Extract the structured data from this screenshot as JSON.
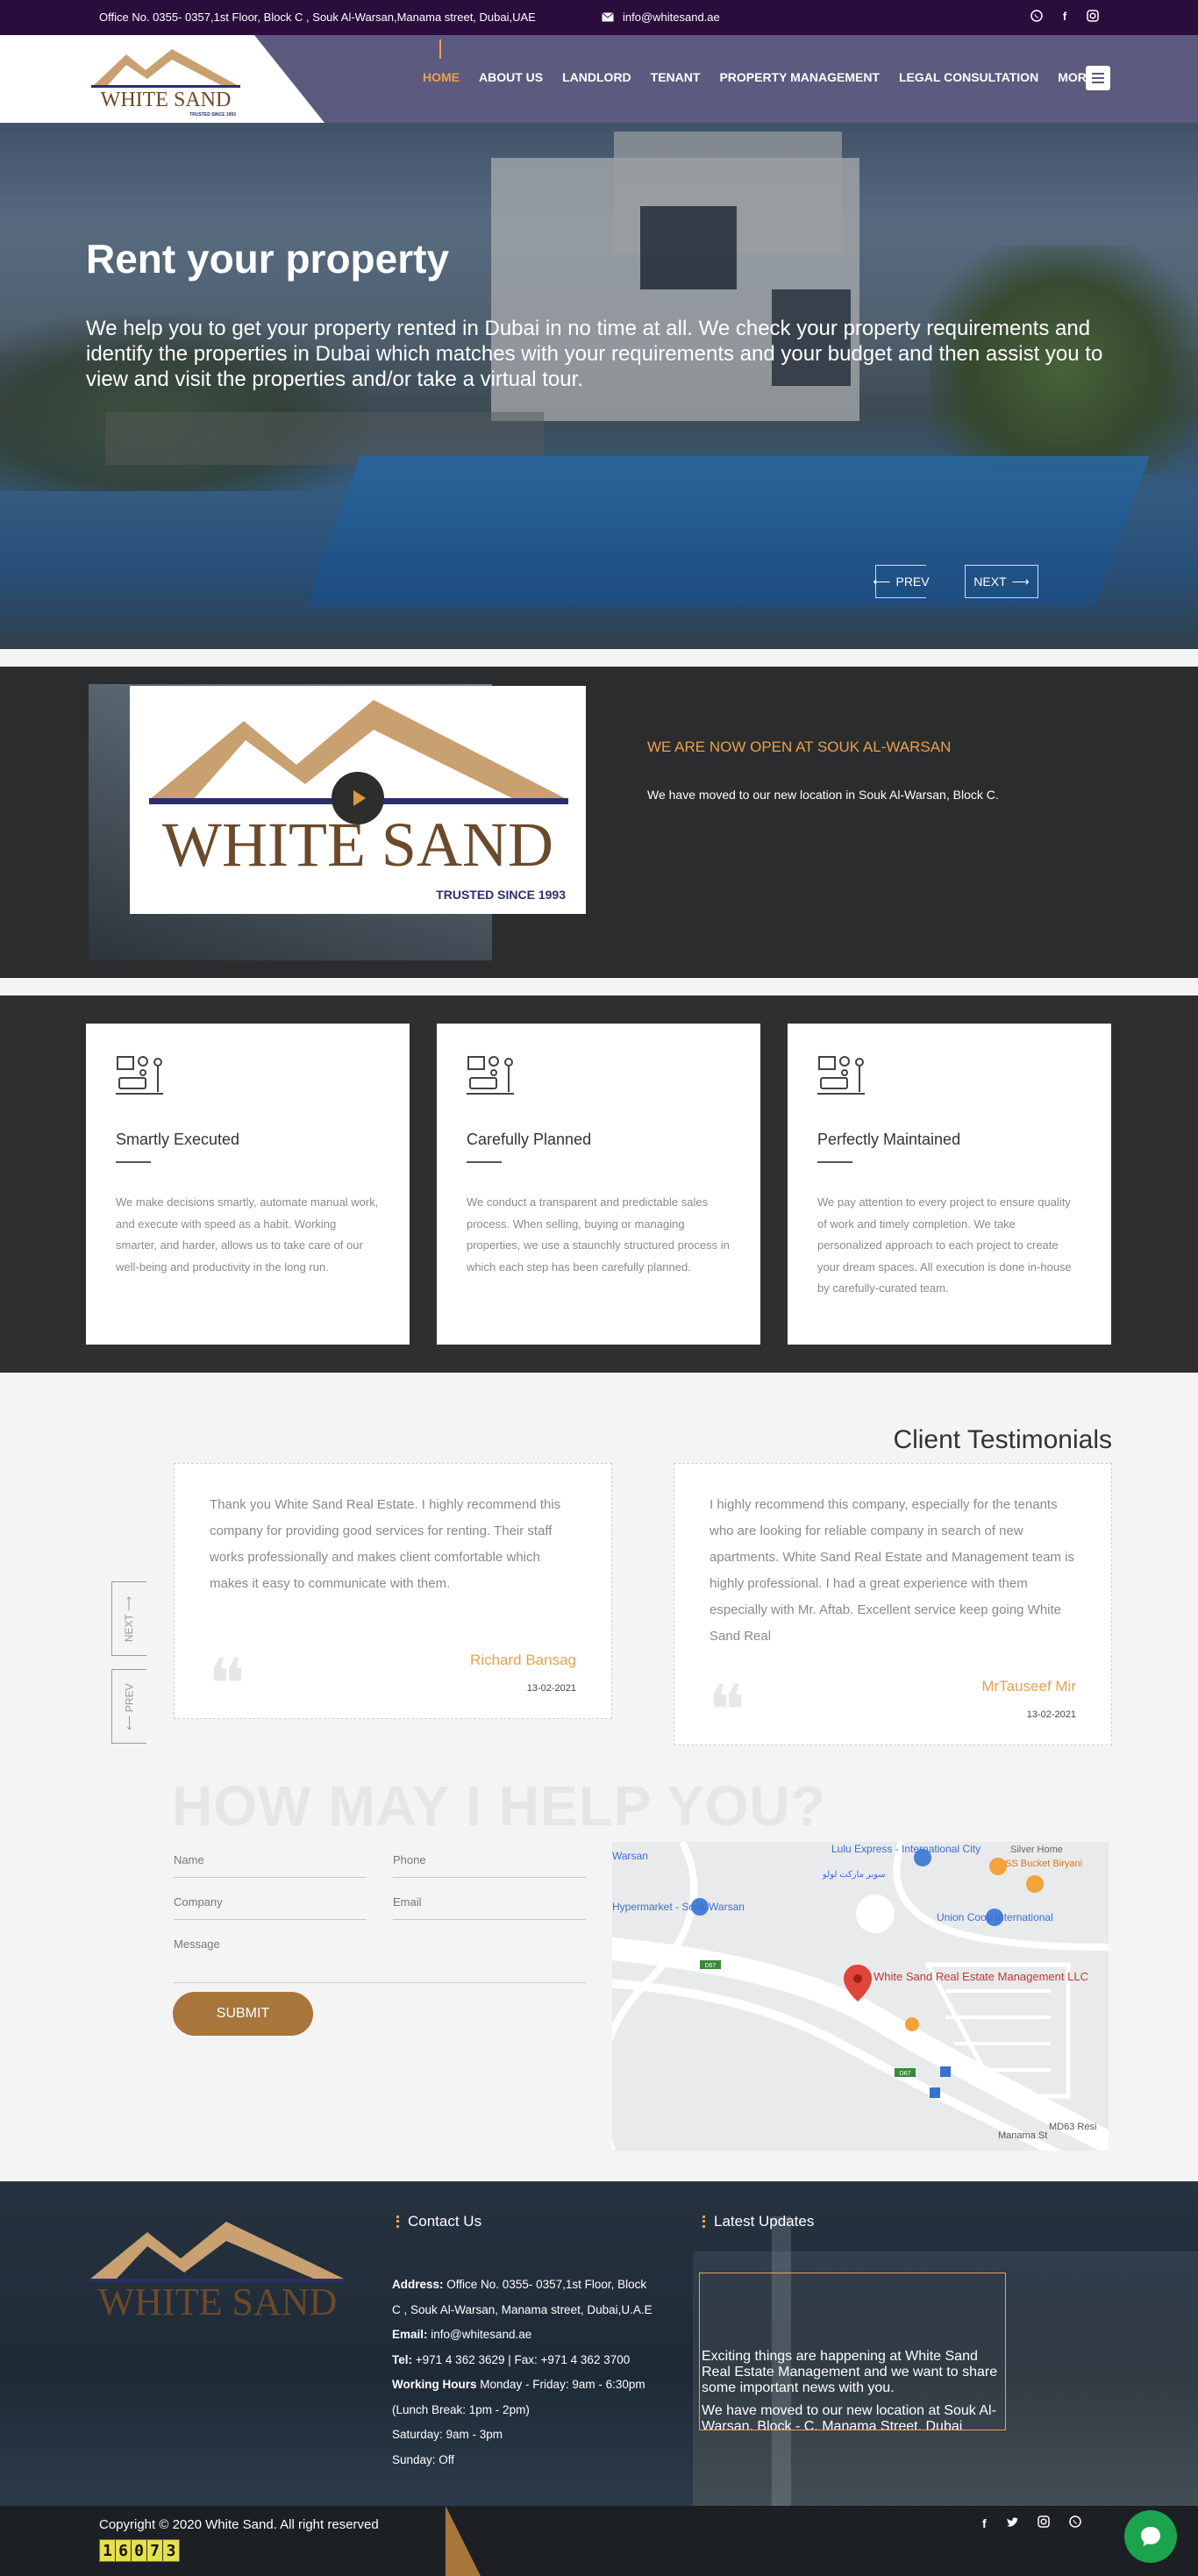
{
  "topbar": {
    "address": "Office No. 0355- 0357,1st Floor, Block C , Souk Al-Warsan,Manama street, Dubai,UAE",
    "email": "info@whitesand.ae",
    "social": [
      "whatsapp-icon",
      "facebook-icon",
      "instagram-icon"
    ]
  },
  "logo": {
    "name": "WHITE SAND",
    "tagline": "TRUSTED SINCE 1993"
  },
  "nav": {
    "items": [
      "HOME",
      "ABOUT US",
      "LANDLORD",
      "TENANT",
      "PROPERTY MANAGEMENT",
      "LEGAL CONSULTATION",
      "MORE"
    ],
    "active": "HOME"
  },
  "hero": {
    "title": "Rent your property",
    "text": "We help you to get your property rented in Dubai in no time at all. We check your property requirements and identify the properties in Dubai which matches with your requirements and your budget and then assist you to view and visit the properties and/or take a virtual tour.",
    "prev": "PREV",
    "next": "NEXT"
  },
  "video": {
    "heading": "WE ARE NOW OPEN AT SOUK AL-WARSAN",
    "message": "We have moved to our new location in Souk Al-Warsan, Block C."
  },
  "features": [
    {
      "title": "Smartly Executed",
      "text": "We make decisions smartly, automate manual work, and execute with speed as a habit. Working smarter, and harder, allows us to take care of our well-being and productivity in the long run."
    },
    {
      "title": "Carefully Planned",
      "text": "We conduct a transparent and predictable sales process. When selling, buying or managing properties, we use a staunchly structured process in which each step has been carefully planned."
    },
    {
      "title": "Perfectly Maintained",
      "text": "We pay attention to every project to ensure quality of work and timely completion. We take personalized approach to each project to create your dream spaces. All execution is done in-house by carefully-curated team."
    }
  ],
  "testimonials": {
    "title": "Client Testimonials",
    "next": "NEXT",
    "prev": "PREV",
    "items": [
      {
        "text": "Thank you White Sand Real Estate. I highly recommend this company for providing good services for renting. Their staff works professionally and makes client comfortable which makes it easy to communicate with them.",
        "name": "Richard Bansag",
        "date": "13-02-2021"
      },
      {
        "text": "I highly recommend this company, especially for the tenants who are looking for reliable company in search of new apartments. White Sand Real Estate and Management team is highly professional. I had a great experience with them especially with Mr. Aftab. Excellent service keep going White Sand Real",
        "name": "MrTauseef Mir",
        "date": "13-02-2021"
      }
    ]
  },
  "contact": {
    "heading": "HOW MAY I HELP YOU?",
    "name": "Name",
    "phone": "Phone",
    "company": "Company",
    "email": "Email",
    "message": "Message",
    "submit": "SUBMIT"
  },
  "map": {
    "labels": [
      "Lulu Express - International City",
      "سوبر ماركت لولو",
      "Silver Home",
      "SS Bucket Biryani",
      "Warsan",
      "Hypermarket - Souk Warsan",
      "Union Coop International",
      "White Sand Real Estate Management LLC",
      "Manama St",
      "MD63 Resi",
      "D67",
      "D67"
    ]
  },
  "footer": {
    "contact_title": "Contact Us",
    "address_label": "Address:",
    "address": "Office No. 0355- 0357,1st Floor, Block C , Souk Al-Warsan, Manama street, Dubai,U.A.E",
    "email_label": "Email:",
    "email": "info@whitesand.ae",
    "tel_label": "Tel:",
    "tel": "+971 4 362 3629 | Fax: +971 4 362 3700",
    "hours_label": "Working Hours",
    "hours": "Monday - Friday: 9am - 6:30pm (Lunch Break: 1pm - 2pm)",
    "saturday": "Saturday: 9am - 3pm",
    "sunday": "Sunday: Off",
    "updates_title": "Latest Updates",
    "update_1": "Exciting things are happening at White Sand Real Estate Management and we want to share some important news with you.",
    "update_2": "We have moved to our new location at Souk Al-Warsan, Block - C, Manama Street, Dubai"
  },
  "bottom": {
    "copyright": "Copyright © 2020 White Sand. All right reserved",
    "counter": [
      "1",
      "6",
      "0",
      "7",
      "3"
    ]
  },
  "colors": {
    "accent": "#e8a24e",
    "header": "#5c5a7f",
    "topbar": "#2a0d3c",
    "brown": "#a8753a"
  }
}
